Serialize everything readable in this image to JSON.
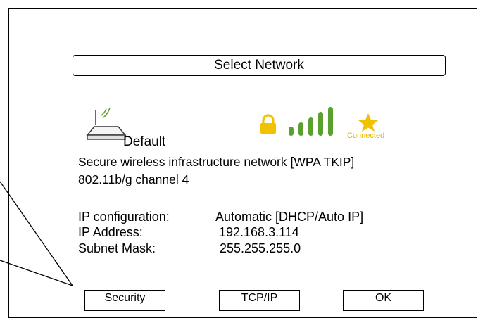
{
  "dialog": {
    "title": "Select Network"
  },
  "network": {
    "name": "Default",
    "description": "Secure wireless infrastructure network [WPA TKIP]",
    "mode": "802.11b/g channel 4",
    "status": "Connected",
    "icons": {
      "access_point": "wireless-router-icon",
      "security": "lock-icon",
      "signal": "signal-strength-icon",
      "favorite": "star-icon"
    },
    "signal_bars": 5,
    "signal_total_bars": 5
  },
  "details": {
    "ip_config_label": "IP configuration:",
    "ip_config_value": "Automatic [DHCP/Auto IP]",
    "ip_address_label": "IP Address:",
    "ip_address_value": "192.168.3.114",
    "subnet_label": "Subnet Mask:",
    "subnet_value": "255.255.255.0"
  },
  "buttons": {
    "security": "Security",
    "tcpip": "TCP/IP",
    "ok": "OK"
  },
  "colors": {
    "accent_gold": "#f2c200",
    "signal_green": "#5aa02c",
    "connected_text": "#e6b800"
  }
}
